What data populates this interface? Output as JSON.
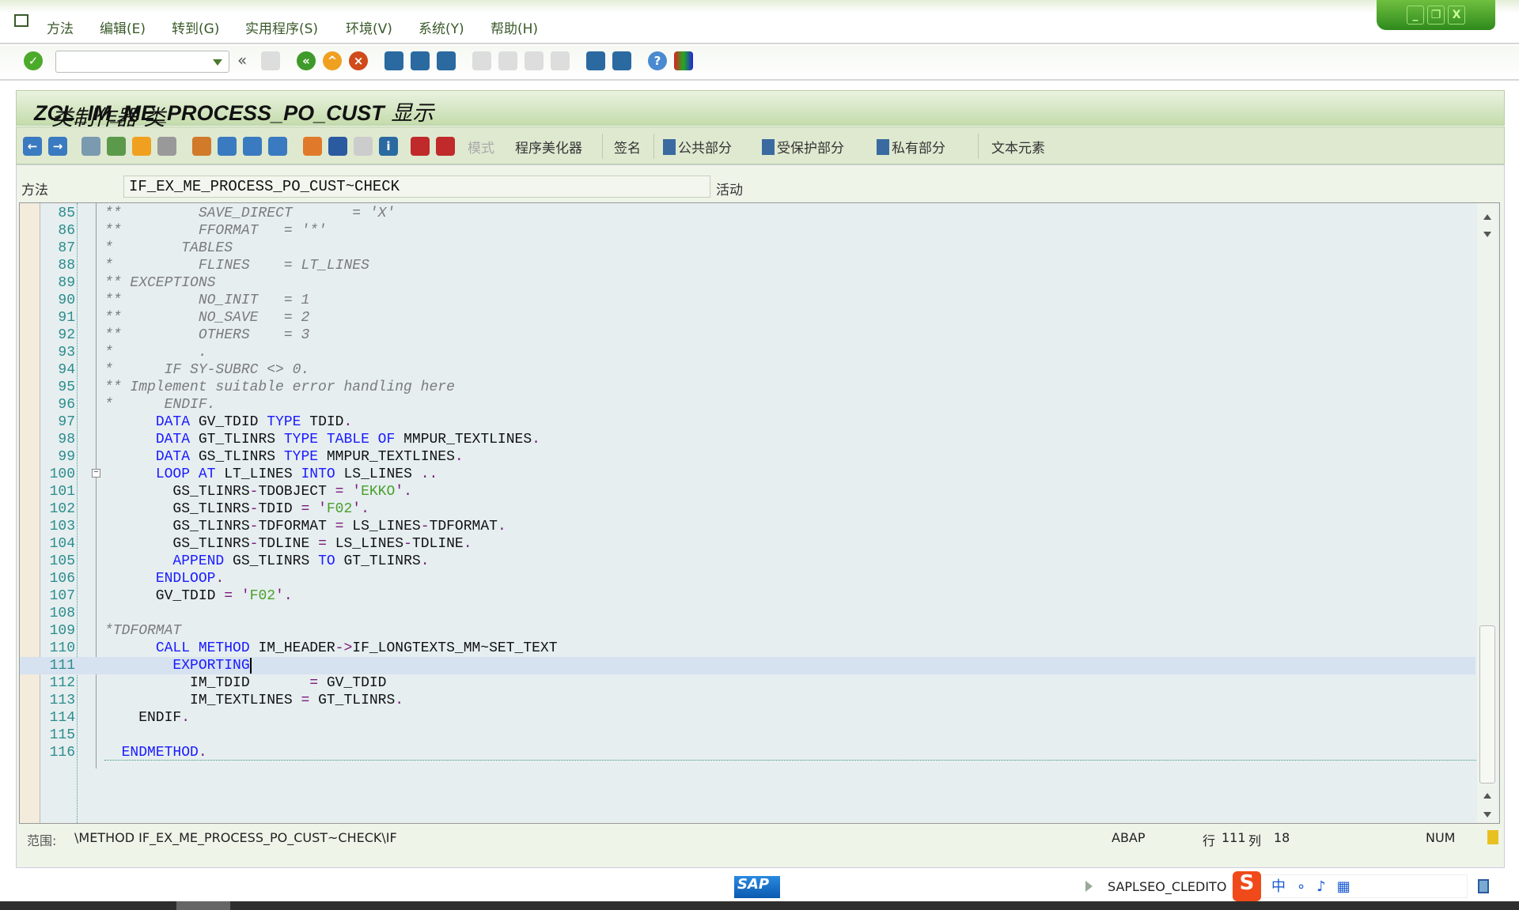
{
  "menu": {
    "items": [
      "方法",
      "编辑(E)",
      "转到(G)",
      "实用程序(S)",
      "环境(V)",
      "系统(Y)",
      "帮助(H)"
    ]
  },
  "window_controls": {
    "minimize": "_",
    "restore": "❐",
    "close": "X"
  },
  "toolbar": {
    "command_field_value": "",
    "collapse": "«"
  },
  "title": {
    "prefix": "类制作器 类 ",
    "class_name": "ZCL_IM_ME_PROCESS_PO_CUST",
    "suffix": " 显示"
  },
  "app_toolbar": {
    "mode": "模式",
    "pretty_printer": "程序美化器",
    "signature": "签名",
    "public_section": "公共部分",
    "protected_section": "受保护部分",
    "private_section": "私有部分",
    "text_elements": "文本元素"
  },
  "method_field": {
    "label": "方法",
    "value": "IF_EX_ME_PROCESS_PO_CUST~CHECK",
    "status": "活动"
  },
  "editor": {
    "current_line": "111",
    "lines": [
      {
        "n": "85",
        "tokens": [
          [
            "c",
            "**         SAVE_DIRECT       = 'X'"
          ]
        ]
      },
      {
        "n": "86",
        "tokens": [
          [
            "c",
            "**         FFORMAT   = '*'"
          ]
        ]
      },
      {
        "n": "87",
        "tokens": [
          [
            "c",
            "*        TABLES"
          ]
        ]
      },
      {
        "n": "88",
        "tokens": [
          [
            "c",
            "*          FLINES    = LT_LINES"
          ]
        ]
      },
      {
        "n": "89",
        "tokens": [
          [
            "c",
            "** EXCEPTIONS"
          ]
        ]
      },
      {
        "n": "90",
        "tokens": [
          [
            "c",
            "**         NO_INIT   = 1"
          ]
        ]
      },
      {
        "n": "91",
        "tokens": [
          [
            "c",
            "**         NO_SAVE   = 2"
          ]
        ]
      },
      {
        "n": "92",
        "tokens": [
          [
            "c",
            "**         OTHERS    = 3"
          ]
        ]
      },
      {
        "n": "93",
        "tokens": [
          [
            "c",
            "*          ."
          ]
        ]
      },
      {
        "n": "94",
        "tokens": [
          [
            "c",
            "*      IF SY-SUBRC <> 0."
          ]
        ]
      },
      {
        "n": "95",
        "tokens": [
          [
            "c",
            "** Implement suitable error handling here"
          ]
        ]
      },
      {
        "n": "96",
        "tokens": [
          [
            "c",
            "*      ENDIF."
          ]
        ]
      },
      {
        "n": "97",
        "tokens": [
          [
            "t",
            "      "
          ],
          [
            "k",
            "DATA"
          ],
          [
            "t",
            " GV_TDID "
          ],
          [
            "k",
            "TYPE"
          ],
          [
            "t",
            " TDID"
          ],
          [
            "o",
            "."
          ]
        ]
      },
      {
        "n": "98",
        "tokens": [
          [
            "t",
            "      "
          ],
          [
            "k",
            "DATA"
          ],
          [
            "t",
            " GT_TLINRS "
          ],
          [
            "k",
            "TYPE TABLE OF"
          ],
          [
            "t",
            " MMPUR_TEXTLINES"
          ],
          [
            "o",
            "."
          ]
        ]
      },
      {
        "n": "99",
        "tokens": [
          [
            "t",
            "      "
          ],
          [
            "k",
            "DATA"
          ],
          [
            "t",
            " GS_TLINRS "
          ],
          [
            "k",
            "TYPE"
          ],
          [
            "t",
            " MMPUR_TEXTLINES"
          ],
          [
            "o",
            "."
          ]
        ]
      },
      {
        "n": "100",
        "tokens": [
          [
            "t",
            "      "
          ],
          [
            "k",
            "LOOP AT"
          ],
          [
            "t",
            " LT_LINES "
          ],
          [
            "k",
            "INTO"
          ],
          [
            "t",
            " LS_LINES "
          ],
          [
            "o",
            ".."
          ]
        ]
      },
      {
        "n": "101",
        "tokens": [
          [
            "t",
            "        GS_TLINRS"
          ],
          [
            "o",
            "-"
          ],
          [
            "t",
            "TDOBJECT "
          ],
          [
            "o",
            "= '"
          ],
          [
            "s",
            "EKKO"
          ],
          [
            "o",
            "'."
          ]
        ]
      },
      {
        "n": "102",
        "tokens": [
          [
            "t",
            "        GS_TLINRS"
          ],
          [
            "o",
            "-"
          ],
          [
            "t",
            "TDID "
          ],
          [
            "o",
            "= '"
          ],
          [
            "s",
            "F02"
          ],
          [
            "o",
            "'."
          ]
        ]
      },
      {
        "n": "103",
        "tokens": [
          [
            "t",
            "        GS_TLINRS"
          ],
          [
            "o",
            "-"
          ],
          [
            "t",
            "TDFORMAT "
          ],
          [
            "o",
            "="
          ],
          [
            "t",
            " LS_LINES"
          ],
          [
            "o",
            "-"
          ],
          [
            "t",
            "TDFORMAT"
          ],
          [
            "o",
            "."
          ]
        ]
      },
      {
        "n": "104",
        "tokens": [
          [
            "t",
            "        GS_TLINRS"
          ],
          [
            "o",
            "-"
          ],
          [
            "t",
            "TDLINE "
          ],
          [
            "o",
            "="
          ],
          [
            "t",
            " LS_LINES"
          ],
          [
            "o",
            "-"
          ],
          [
            "t",
            "TDLINE"
          ],
          [
            "o",
            "."
          ]
        ]
      },
      {
        "n": "105",
        "tokens": [
          [
            "t",
            "        "
          ],
          [
            "k",
            "APPEND"
          ],
          [
            "t",
            " GS_TLINRS "
          ],
          [
            "k",
            "TO"
          ],
          [
            "t",
            " GT_TLINRS"
          ],
          [
            "o",
            "."
          ]
        ]
      },
      {
        "n": "106",
        "tokens": [
          [
            "t",
            "      "
          ],
          [
            "k",
            "ENDLOOP"
          ],
          [
            "o",
            "."
          ]
        ]
      },
      {
        "n": "107",
        "tokens": [
          [
            "t",
            "      GV_TDID "
          ],
          [
            "o",
            "= '"
          ],
          [
            "s",
            "F02"
          ],
          [
            "o",
            "'."
          ]
        ]
      },
      {
        "n": "108",
        "tokens": []
      },
      {
        "n": "109",
        "tokens": [
          [
            "c",
            "*TDFORMAT"
          ]
        ]
      },
      {
        "n": "110",
        "tokens": [
          [
            "t",
            "      "
          ],
          [
            "k",
            "CALL METHOD"
          ],
          [
            "t",
            " IM_HEADER"
          ],
          [
            "o",
            "->"
          ],
          [
            "t",
            "IF_LONGTEXTS_MM~SET_TEXT"
          ]
        ]
      },
      {
        "n": "111",
        "tokens": [
          [
            "t",
            "        "
          ],
          [
            "k",
            "EXPORTING"
          ]
        ]
      },
      {
        "n": "112",
        "tokens": [
          [
            "t",
            "          IM_TDID       "
          ],
          [
            "o",
            "="
          ],
          [
            "t",
            " GV_TDID"
          ]
        ]
      },
      {
        "n": "113",
        "tokens": [
          [
            "t",
            "          IM_TEXTLINES "
          ],
          [
            "o",
            "="
          ],
          [
            "t",
            " GT_TLINRS"
          ],
          [
            "o",
            "."
          ]
        ]
      },
      {
        "n": "114",
        "tokens": [
          [
            "t",
            "    ENDIF"
          ],
          [
            "o",
            "."
          ]
        ]
      },
      {
        "n": "115",
        "tokens": []
      },
      {
        "n": "116",
        "tokens": [
          [
            "t",
            "  "
          ],
          [
            "k",
            "ENDMETHOD"
          ],
          [
            "o",
            "."
          ]
        ]
      }
    ]
  },
  "status_line": {
    "scope_label": "范围:",
    "scope_value": "\\METHOD IF_EX_ME_PROCESS_PO_CUST~CHECK\\IF",
    "language": "ABAP",
    "row_label": "行",
    "row": "111",
    "col_label": "列",
    "col": "18",
    "num": "NUM"
  },
  "sap_status": {
    "logo": "SAP",
    "program": "SAPLSEO_CLEDITO"
  },
  "colors": {
    "keyword": "#1a1aff",
    "comment": "#7b7b7b",
    "string": "#4aa02c",
    "title_bg": "#c4dcac"
  }
}
